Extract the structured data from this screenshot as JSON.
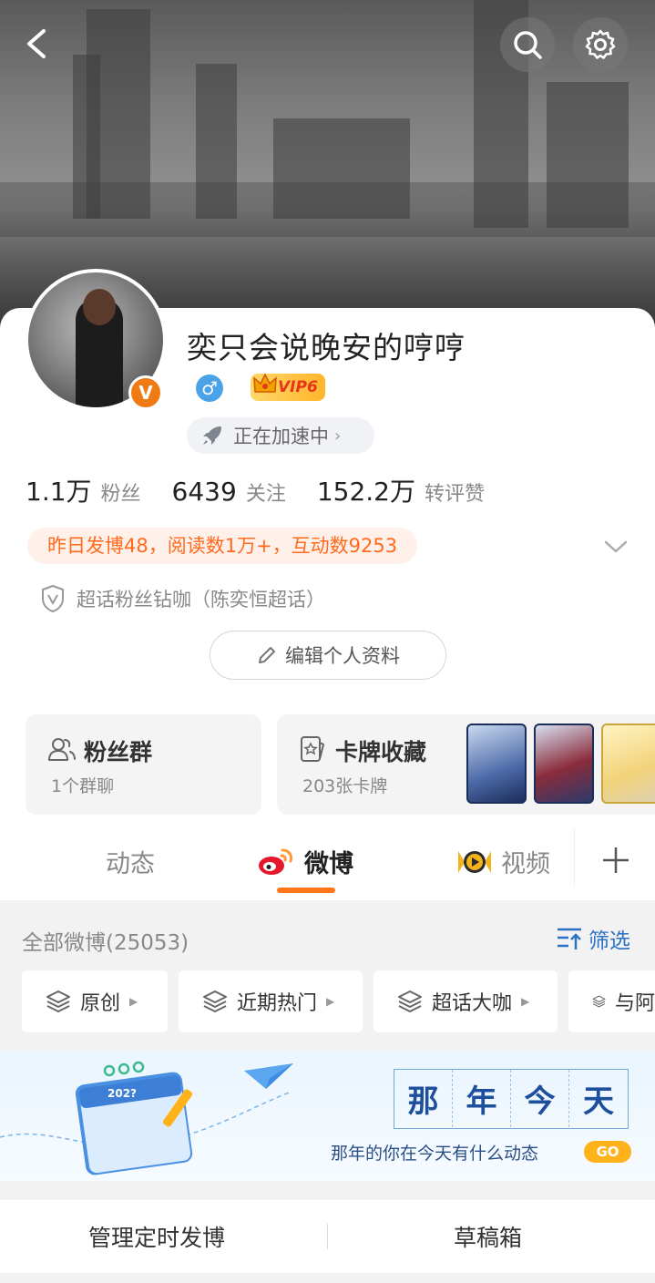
{
  "nav": {
    "back_icon": "chevron-left-icon",
    "search_icon": "search-icon",
    "settings_icon": "gear-icon"
  },
  "profile": {
    "username": "奕只会说晚安的哼哼",
    "verified_badge": "V",
    "gender_symbol": "♂",
    "vip_label": "VIP6",
    "accelerate_label": "正在加速中",
    "accelerate_chevron": "›"
  },
  "stats": [
    {
      "value": "1.1万",
      "label": "粉丝"
    },
    {
      "value": "6439",
      "label": "关注"
    },
    {
      "value": "152.2万",
      "label": "转评赞"
    }
  ],
  "daily_summary": "昨日发博48，阅读数1万+，互动数9253",
  "super_topic": "超话粉丝钻咖（陈奕恒超话）",
  "edit_profile_label": "编辑个人资料",
  "fan_group": {
    "title": "粉丝群",
    "subtitle": "1个群聊"
  },
  "card_collection": {
    "title": "卡牌收藏",
    "subtitle": "203张卡牌"
  },
  "tabs": [
    {
      "label": "动态",
      "active": false
    },
    {
      "label": "微博",
      "active": true
    },
    {
      "label": "视频",
      "active": false
    }
  ],
  "feed": {
    "all_label": "全部微博(25053)",
    "filter_label": "筛选",
    "chips": [
      "原创",
      "近期热门",
      "超话大咖",
      "与阿"
    ]
  },
  "banner": {
    "title_chars": [
      "那",
      "年",
      "今",
      "天"
    ],
    "slogan": "那年的你在今天有什么动态",
    "go_label": "GO",
    "calendar_year": "202?"
  },
  "bottom_actions": {
    "scheduled": "管理定时发博",
    "drafts": "草稿箱"
  },
  "colors": {
    "accent": "#ff7519",
    "link": "#2a73c4",
    "orange_text": "#ff6a1e"
  }
}
